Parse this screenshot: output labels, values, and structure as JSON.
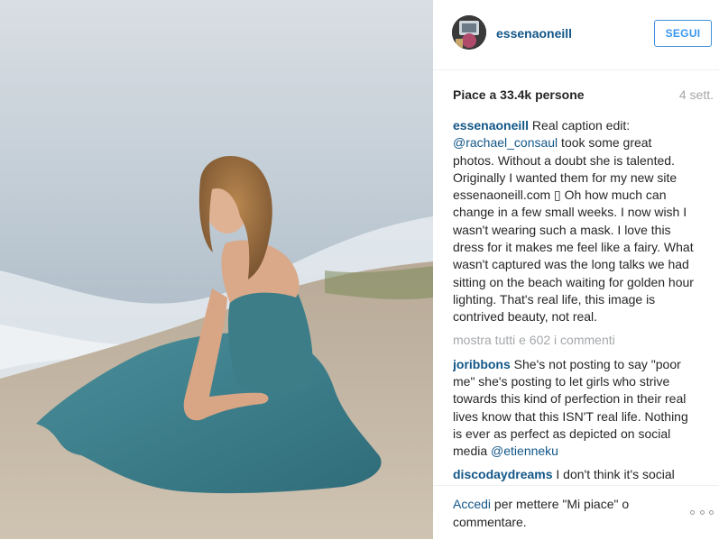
{
  "post": {
    "image_description_icon": "photo",
    "username": "essenaoneill",
    "follow_label": "SEGUI",
    "likes_text": "Piace a 33.4k persone",
    "time_ago": "4 sett.",
    "caption": {
      "user": "essenaoneill",
      "text_before_mention": " Real caption edit: ",
      "mention": "@rachael_consaul",
      "text_after_mention": " took some great photos. Without a doubt she is talented. Originally I wanted them for my new site essenaoneill.com ▯ Oh how much can change in a few small weeks. I now wish I wasn't wearing such a mask. I love this dress for it makes me feel like a fairy. What wasn't captured was the long talks we had sitting on the beach waiting for golden hour lighting. That's real life, this image is contrived beauty, not real."
    },
    "show_all_comments": "mostra tutti e 602 i commenti",
    "comments": [
      {
        "user": "joribbons",
        "text": " She's not posting to say \"poor me\" she's posting to let girls who strive towards this kind of perfection in their real lives know that this ISN'T real life. Nothing is ever as perfect as depicted on social media ",
        "mention": "@etienneku"
      },
      {
        "user": "discodaydreams",
        "text": " I don't think it's social media your upset about but more so the",
        "mention": ""
      }
    ],
    "footer": {
      "login_link": "Accedi",
      "login_rest": " per mettere \"Mi piace\" o commentare."
    }
  },
  "colors": {
    "link_blue": "#125688",
    "button_blue": "#3897f0",
    "muted_gray": "#a5a7aa",
    "dress_teal": "#3e7f8c"
  }
}
